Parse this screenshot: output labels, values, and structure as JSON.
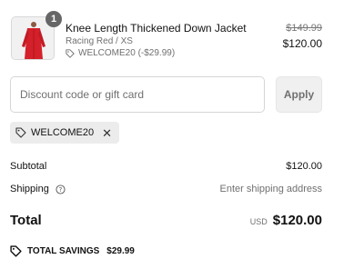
{
  "line_item": {
    "quantity": "1",
    "name": "Knee Length Thickened Down Jacket",
    "variant": "Racing Red / XS",
    "discount_label": "WELCOME20 (-$29.99)",
    "compare_price": "$149.99",
    "price": "$120.00",
    "product_color": "#d4202a"
  },
  "discount": {
    "placeholder": "Discount code or gift card",
    "apply_label": "Apply",
    "applied_code": "WELCOME20"
  },
  "summary": {
    "subtotal_label": "Subtotal",
    "subtotal_value": "$120.00",
    "shipping_label": "Shipping",
    "shipping_value": "Enter shipping address",
    "total_label": "Total",
    "currency": "USD",
    "total_value": "$120.00",
    "savings_label": "TOTAL SAVINGS",
    "savings_value": "$29.99"
  }
}
